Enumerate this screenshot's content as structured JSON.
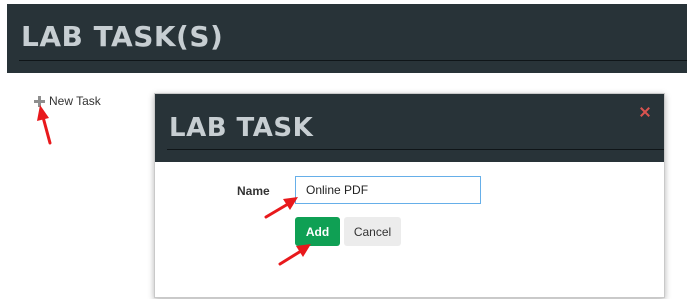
{
  "page": {
    "title": "LAB TASK(S)",
    "new_task_label": "New Task"
  },
  "modal": {
    "title": "LAB TASK",
    "name_label": "Name",
    "name_value": "Online PDF",
    "add_label": "Add",
    "cancel_label": "Cancel",
    "close_icon": "close-icon"
  },
  "colors": {
    "header_bg": "#283338",
    "title_text": "#c7ced2",
    "add_button": "#0fa054",
    "annotation_arrow": "#e8191c"
  }
}
